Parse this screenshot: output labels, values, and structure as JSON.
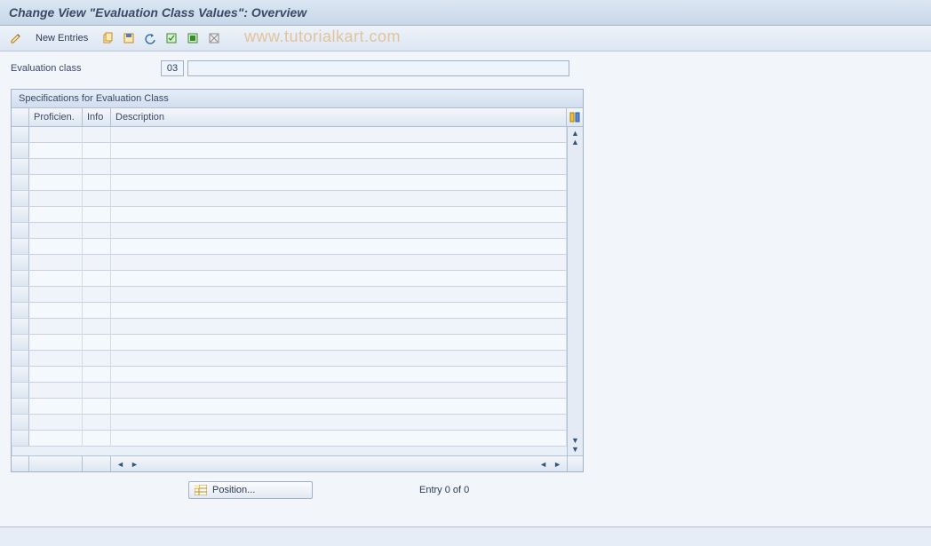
{
  "title": "Change View \"Evaluation Class Values\": Overview",
  "toolbar": {
    "new_entries_label": "New Entries"
  },
  "watermark": "www.tutorialkart.com",
  "eval_class": {
    "label": "Evaluation class",
    "code": "03",
    "desc": ""
  },
  "panel": {
    "title": "Specifications for Evaluation Class",
    "columns": {
      "proficiency": "Proficien.",
      "info": "Info",
      "description": "Description"
    }
  },
  "footer": {
    "position_label": "Position...",
    "entry_status": "Entry 0 of 0"
  }
}
